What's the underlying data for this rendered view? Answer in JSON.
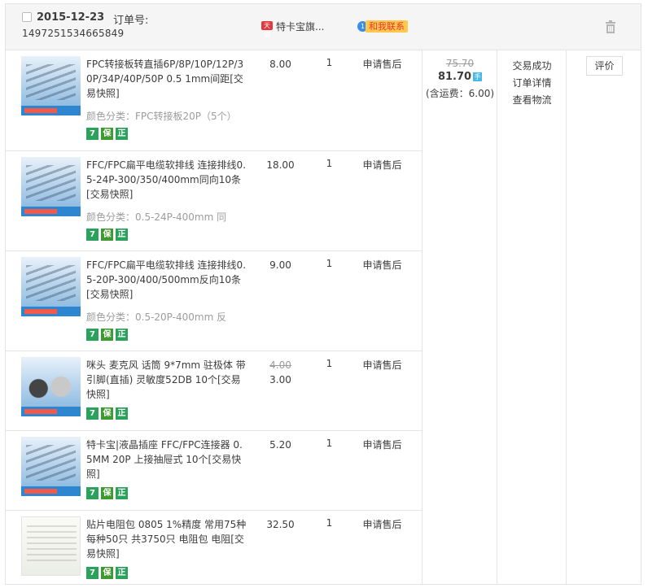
{
  "header": {
    "date": "2015-12-23",
    "order_label": "订单号:",
    "order_number": "1497251534665849",
    "shop_icon": "天猫",
    "shop_name": "特卡宝旗...",
    "contact_label": "和我联系",
    "contact_icon_text": "1"
  },
  "items": [
    {
      "title": "FPC转接板转直插6P/8P/10P/12P/30P/34P/40P/50P 0.5 1mm间距[交易快照]",
      "spec": "颜色分类：FPC转接板20P（5个）",
      "price": "8.00",
      "old_price": "",
      "qty": "1",
      "aftersale": "申请售后"
    },
    {
      "title": "FFC/FPC扁平电缆软排线 连接排线0.5-24P-300/350/400mm同向10条[交易快照]",
      "spec": "颜色分类：0.5-24P-400mm 同",
      "price": "18.00",
      "old_price": "",
      "qty": "1",
      "aftersale": "申请售后"
    },
    {
      "title": "FFC/FPC扁平电缆软排线 连接排线0.5-20P-300/400/500mm反向10条[交易快照]",
      "spec": "颜色分类：0.5-20P-400mm 反",
      "price": "9.00",
      "old_price": "",
      "qty": "1",
      "aftersale": "申请售后"
    },
    {
      "title": "咪头 麦克风 话筒 9*7mm 驻极体 带引脚(直插) 灵敏度52DB 10个[交易快照]",
      "spec": "",
      "price": "3.00",
      "old_price": "4.00",
      "qty": "1",
      "aftersale": "申请售后"
    },
    {
      "title": "特卡宝|液晶插座 FFC/FPC连接器 0.5MM 20P 上接抽屉式 10个[交易快照]",
      "spec": "",
      "price": "5.20",
      "old_price": "",
      "qty": "1",
      "aftersale": "申请售后"
    },
    {
      "title": "贴片电阻包 0805 1%精度 常用75种每种50只 共3750只 电阻包 电阻[交易快照]",
      "spec": "",
      "price": "32.50",
      "old_price": "",
      "qty": "1",
      "aftersale": "申请售后"
    }
  ],
  "tags": [
    "7",
    "保",
    "正"
  ],
  "summary": {
    "old_total": "75.70",
    "total": "81.70",
    "mobile_icon": "手",
    "freight": "(含运费：6.00)",
    "status": [
      "交易成功",
      "订单详情",
      "查看物流"
    ],
    "rate_button": "评价"
  },
  "icons": {
    "trash": "trash-icon",
    "checkbox": "checkbox-icon"
  }
}
